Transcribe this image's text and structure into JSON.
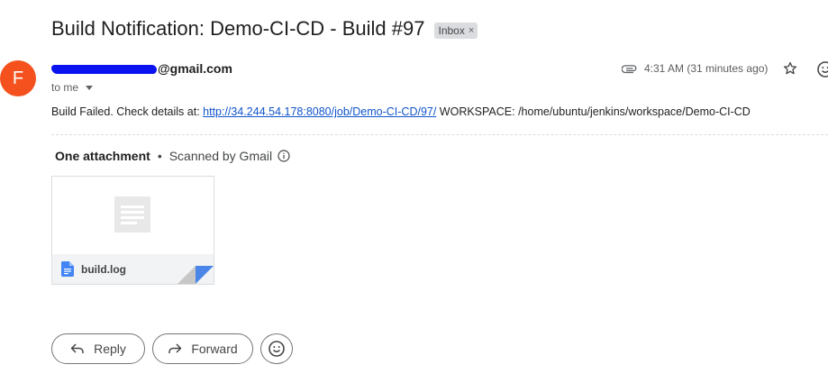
{
  "email": {
    "subject": "Build Notification: Demo-CI-CD - Build #97",
    "label_chip": "Inbox",
    "label_chip_close": "×",
    "sender": {
      "avatar_initial": "F",
      "avatar_color": "#f4511e",
      "address_visible_part": "@gmail.com"
    },
    "recipient_text": "to me",
    "time": "4:31 AM (31 minutes ago)",
    "body": {
      "prefix": "Build Failed. Check details at: ",
      "link_text": "http://34.244.54.178:8080/job/Demo-CI-CD/97/",
      "suffix": " WORKSPACE: /home/ubuntu/jenkins/workspace/Demo-CI-CD"
    },
    "attachments": {
      "count_label": "One attachment",
      "separator": "•",
      "scan_label": "Scanned by Gmail",
      "files": [
        {
          "name": "build.log",
          "icon": "google-docs-icon"
        }
      ]
    },
    "actions": {
      "reply": "Reply",
      "forward": "Forward"
    }
  },
  "colors": {
    "link": "#1155cc",
    "chip_bg": "#dadce0",
    "file_icon": "#4285f4"
  }
}
